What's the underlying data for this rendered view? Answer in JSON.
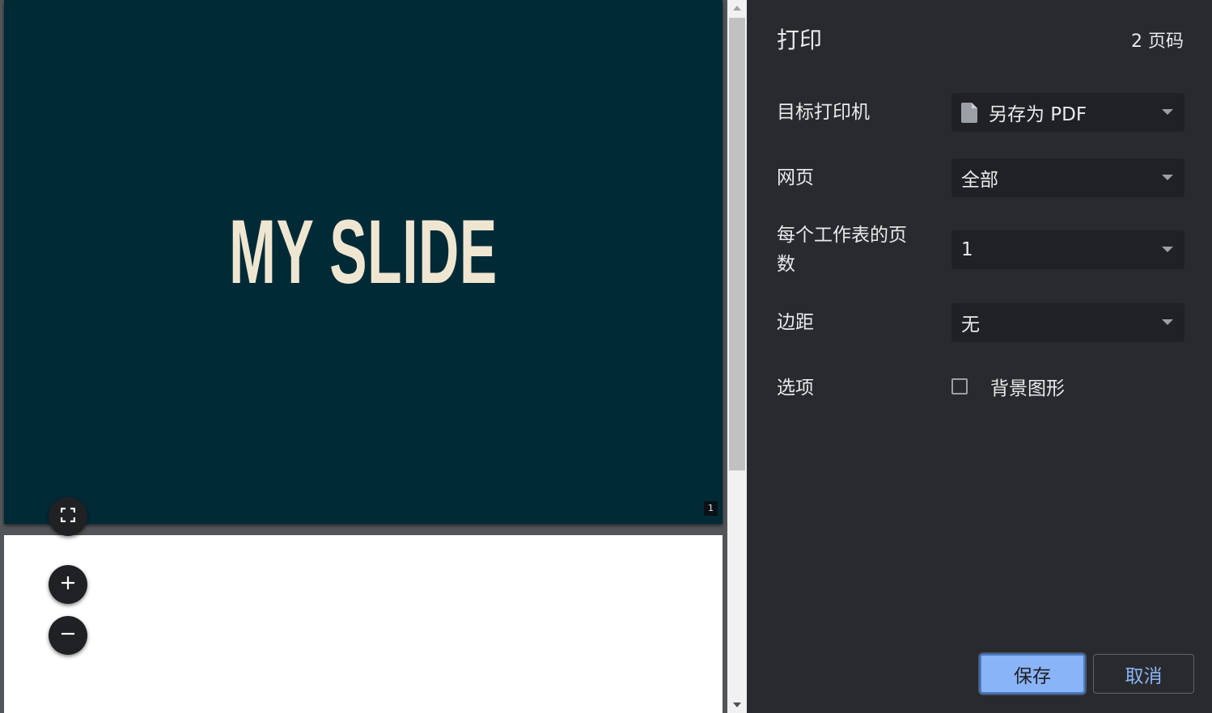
{
  "preview": {
    "slide_title": "MY SLIDE",
    "page_badge": "1",
    "slide_bg_color": "#002a36",
    "slide_text_color": "#efe6d2",
    "controls": {
      "fit_icon": "fit-to-page-icon",
      "zoom_in_icon": "plus-icon",
      "zoom_out_icon": "minus-icon"
    }
  },
  "sidebar": {
    "title": "打印",
    "page_count": "2 页码",
    "destination": {
      "label": "目标打印机",
      "value": "另存为 PDF",
      "icon": "document-icon"
    },
    "pages": {
      "label": "网页",
      "value": "全部"
    },
    "pages_per_sheet": {
      "label": "每个工作表的页数",
      "value": "1"
    },
    "margins": {
      "label": "边距",
      "value": "无"
    },
    "options": {
      "label": "选项",
      "background_graphics_label": "背景图形",
      "background_graphics_checked": false
    },
    "buttons": {
      "save": "保存",
      "cancel": "取消"
    },
    "accent_color": "#8ab4f8"
  }
}
